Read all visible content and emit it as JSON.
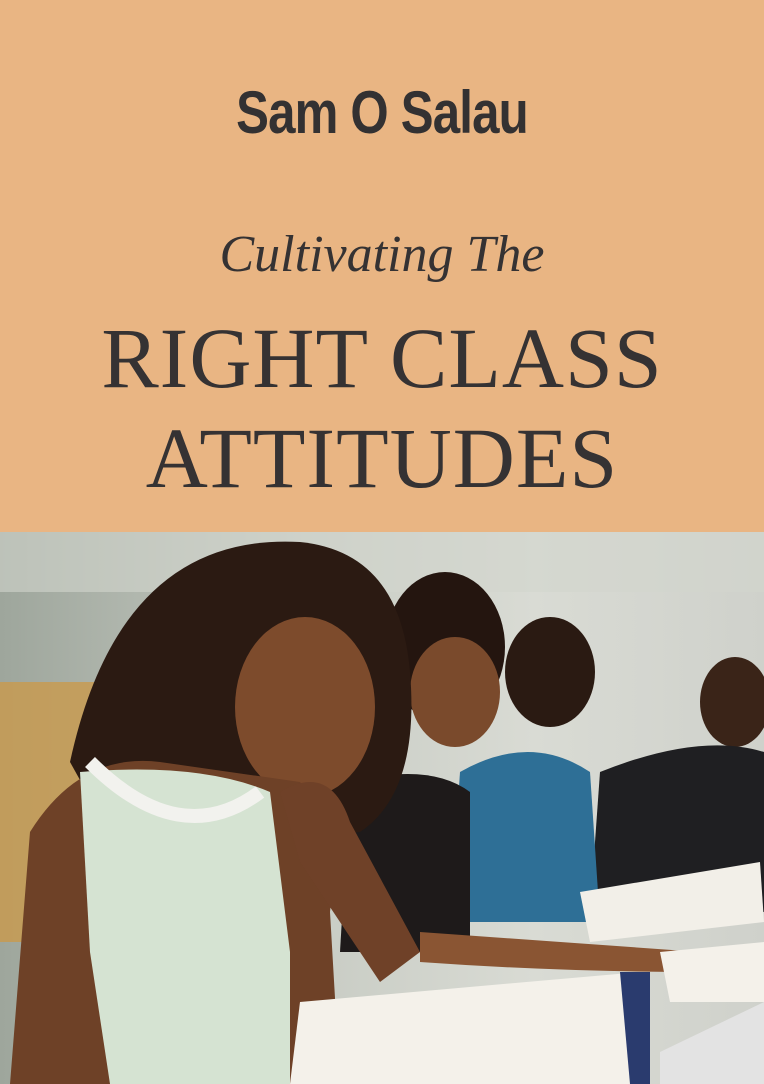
{
  "cover": {
    "author": "Sam O Salau",
    "subtitle": "Cultivating The",
    "title_line1": "RIGHT CLASS",
    "title_line2": "ATTITUDES"
  },
  "colors": {
    "background": "#E9B583",
    "text": "#353233"
  }
}
